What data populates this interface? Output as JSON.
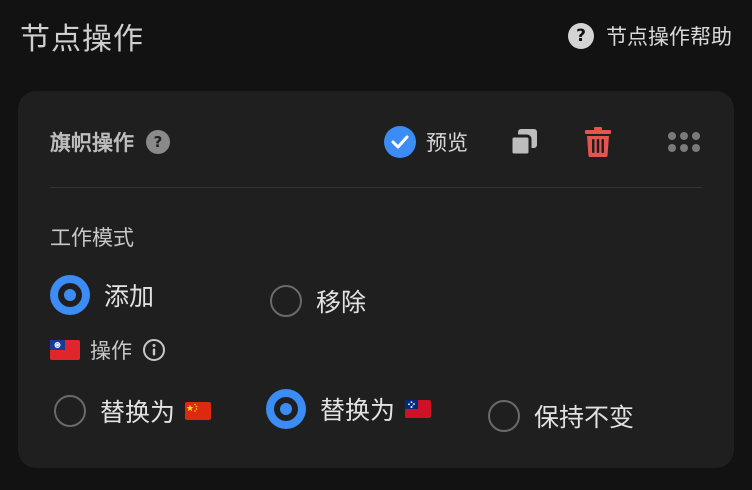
{
  "header": {
    "title": "节点操作",
    "help_label": "节点操作帮助",
    "help_icon": "question-circle-icon"
  },
  "card": {
    "title": "旗帜操作",
    "help_icon": "question-circle-icon",
    "preview": {
      "label": "预览",
      "checked": true
    },
    "actions": {
      "copy_icon": "copy-icon",
      "delete_icon": "trash-icon",
      "drag_icon": "grip-dots-icon"
    },
    "mode": {
      "label": "工作模式",
      "options": [
        {
          "label": "添加",
          "selected": true
        },
        {
          "label": "移除",
          "selected": false
        }
      ]
    },
    "operation": {
      "flag_icon": "taiwan-flag-icon",
      "label": "操作",
      "info_icon": "info-circle-icon",
      "options": [
        {
          "label": "替换为",
          "flag": "china-flag-icon",
          "selected": false
        },
        {
          "label": "替换为",
          "flag": "samoa-flag-icon",
          "selected": true
        },
        {
          "label": "保持不变",
          "selected": false
        }
      ]
    }
  },
  "colors": {
    "accent": "#3b8cf5",
    "danger": "#e5554f",
    "card_bg": "#1f1f1f",
    "page_bg": "#121212"
  }
}
